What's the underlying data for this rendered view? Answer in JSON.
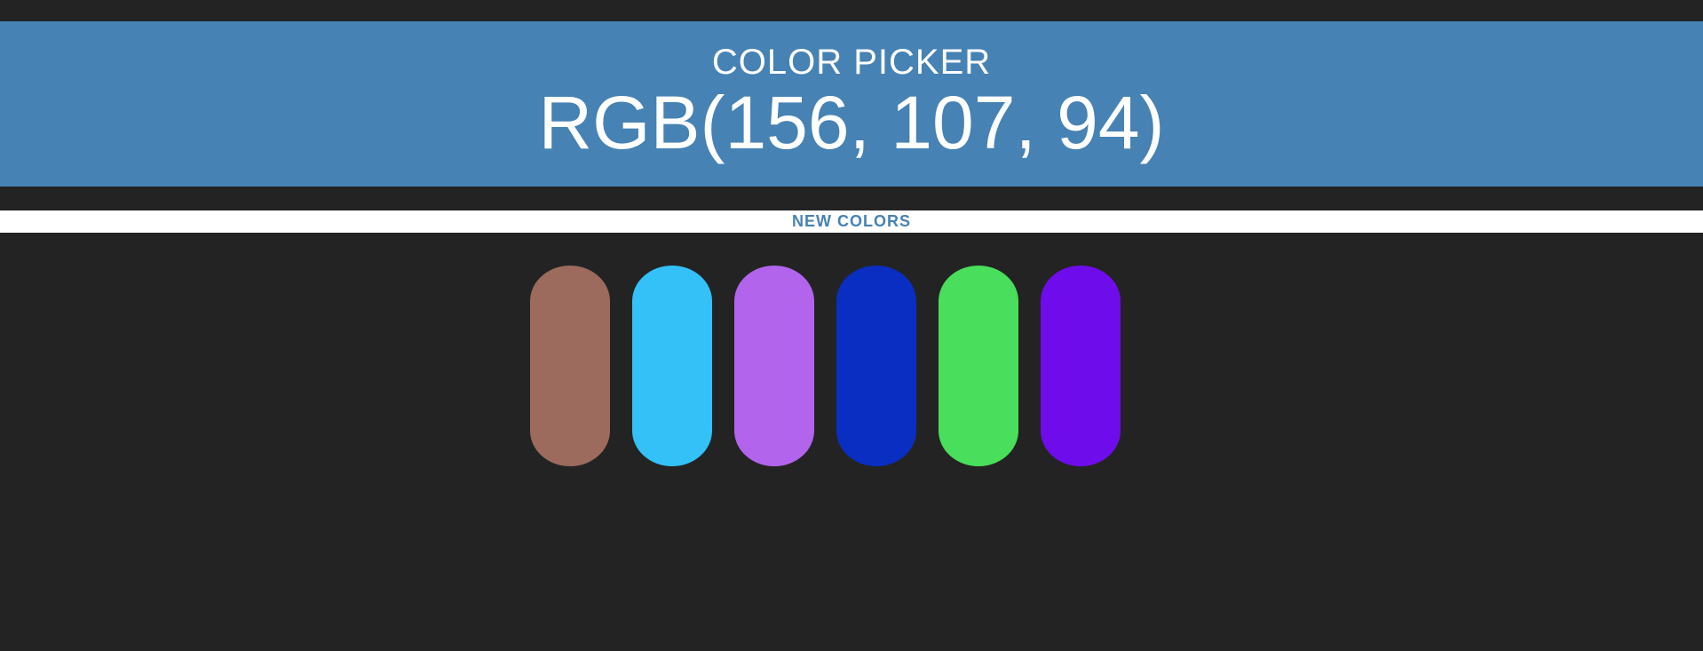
{
  "header": {
    "title": "COLOR PICKER",
    "rgb_display": "RGB(156, 107, 94)"
  },
  "controls": {
    "new_colors_label": "NEW COLORS"
  },
  "squares": [
    {
      "color": "#9c6b5e"
    },
    {
      "color": "#33c1f8"
    },
    {
      "color": "#b265ec"
    },
    {
      "color": "#0a2ec2"
    },
    {
      "color": "#49de5b"
    },
    {
      "color": "#6f0ceb"
    }
  ],
  "colors": {
    "background": "#232323",
    "header": "#4682b4",
    "strip": "#ffffff",
    "accent_text": "#4682b4"
  }
}
